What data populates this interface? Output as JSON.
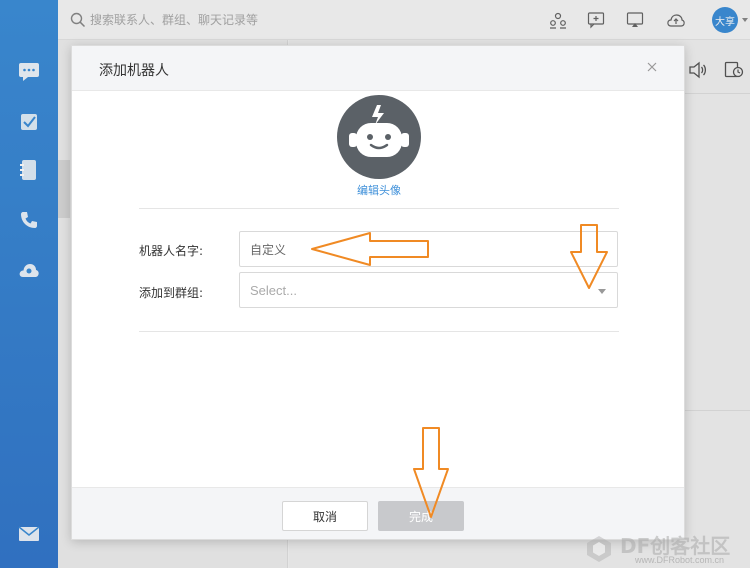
{
  "search": {
    "placeholder": "搜索联系人、群组、聊天记录等"
  },
  "user": {
    "avatar_text": "大享"
  },
  "dialog": {
    "title": "添加机器人",
    "edit_avatar": "编辑头像",
    "name_label": "机器人名字:",
    "name_value": "自定义",
    "group_label": "添加到群组:",
    "group_placeholder": "Select...",
    "cancel_label": "取消",
    "done_label": "完成"
  },
  "watermark": {
    "text": "DF创客社区",
    "sub": "www.DFRobot.com.cn"
  },
  "colors": {
    "nav_blue": "#3d8fd9",
    "annotation_orange": "#f08a24",
    "bot_avatar": "#5b6167",
    "disabled_button": "#c8c9cc"
  },
  "icons": {
    "leftnav": [
      "chat-icon",
      "tasks-icon",
      "contacts-icon",
      "phone-icon",
      "cloud-icon",
      "mail-icon"
    ],
    "topbar": [
      "search-icon",
      "group-add-icon",
      "new-chat-icon",
      "screen-share-icon",
      "cloud-upload-icon"
    ],
    "right": [
      "speaker-icon",
      "history-icon"
    ],
    "dialog": [
      "close-icon",
      "robot-face-icon"
    ]
  }
}
